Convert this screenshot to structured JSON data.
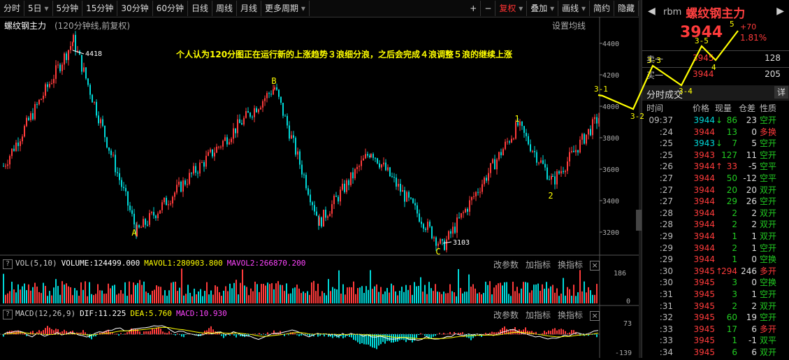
{
  "toolbar": {
    "items": [
      "分时",
      "5日",
      "5分钟",
      "15分钟",
      "30分钟",
      "60分钟",
      "日线",
      "周线",
      "月线",
      "更多周期"
    ],
    "right_items": [
      "+",
      "−",
      "复权",
      "叠加",
      "画线",
      "简约",
      "隐藏"
    ],
    "dropdown_items": [
      "5日",
      "更多周期",
      "复权",
      "叠加",
      "画线"
    ],
    "active_item": "复权"
  },
  "main_chart": {
    "symbol_label": "螺纹钢主力",
    "period_label": "(120分钟线,前复权)",
    "settings_label": "设置均线",
    "annotation": "个人认为120分图正在运行新的上涨趋势３浪细分浪，之后会完成４浪调整５浪的继续上涨",
    "high_label": "4418",
    "low_label": "3103",
    "wave_labels": [
      "A",
      "B",
      "C",
      "1",
      "2"
    ],
    "forecast_labels": [
      "3-1",
      "3-2",
      "3-3",
      "3-4",
      "3-5",
      "4",
      "5"
    ],
    "colors": {
      "up": "#ff3b3b",
      "down": "#00d8d8",
      "annotation": "#ffff00",
      "wave": "#ffff00"
    }
  },
  "volume_panel": {
    "indicator_label": "VOL(5,10)",
    "volume_text": "VOLUME:124499.000",
    "mavol1_text": "MAVOL1:280903.800",
    "mavol2_text": "MAVOL2:266870.200",
    "buttons": [
      "改参数",
      "加指标",
      "换指标"
    ],
    "axis_labels": [
      "186",
      "0"
    ]
  },
  "macd_panel": {
    "indicator_label": "MACD(12,26,9)",
    "dif_text": "DIF:11.225",
    "dea_text": "DEA:5.760",
    "macd_text": "MACD:10.930",
    "buttons": [
      "改参数",
      "加指标",
      "换指标"
    ],
    "axis_labels": [
      "73",
      "-139"
    ]
  },
  "quote_panel": {
    "code": "rbm",
    "name": "螺纹钢主力",
    "price": "3944",
    "change": "+70",
    "change_pct": "1.81%",
    "ask_label": "卖一",
    "ask_price": "3945",
    "ask_vol": "128",
    "bid_label": "买一",
    "bid_price": "3944",
    "bid_vol": "205",
    "tab_label": "分时成交",
    "detail_label": "详",
    "columns": [
      "时间",
      "价格",
      "现量",
      "仓差",
      "性质"
    ],
    "ticks": [
      {
        "time": "09:37",
        "price": "3944",
        "dir": "↓",
        "vol": "86",
        "oi": "23",
        "nature": "空开"
      },
      {
        "time": ":24",
        "price": "3944",
        "dir": "",
        "vol": "13",
        "oi": "0",
        "nature": "多换"
      },
      {
        "time": ":25",
        "price": "3943",
        "dir": "↓",
        "vol": "7",
        "oi": "5",
        "nature": "空开"
      },
      {
        "time": ":25",
        "price": "3943",
        "dir": "",
        "vol": "127",
        "oi": "11",
        "nature": "空开"
      },
      {
        "time": ":26",
        "price": "3944",
        "dir": "↑",
        "vol": "33",
        "oi": "-5",
        "nature": "空平"
      },
      {
        "time": ":27",
        "price": "3944",
        "dir": "",
        "vol": "50",
        "oi": "-12",
        "nature": "空平"
      },
      {
        "time": ":27",
        "price": "3944",
        "dir": "",
        "vol": "20",
        "oi": "20",
        "nature": "双开"
      },
      {
        "time": ":27",
        "price": "3944",
        "dir": "",
        "vol": "29",
        "oi": "26",
        "nature": "空开"
      },
      {
        "time": ":28",
        "price": "3944",
        "dir": "",
        "vol": "2",
        "oi": "2",
        "nature": "双开"
      },
      {
        "time": ":28",
        "price": "3944",
        "dir": "",
        "vol": "2",
        "oi": "2",
        "nature": "双开"
      },
      {
        "time": ":29",
        "price": "3944",
        "dir": "",
        "vol": "1",
        "oi": "1",
        "nature": "双开"
      },
      {
        "time": ":29",
        "price": "3944",
        "dir": "",
        "vol": "2",
        "oi": "1",
        "nature": "空开"
      },
      {
        "time": ":29",
        "price": "3944",
        "dir": "",
        "vol": "1",
        "oi": "0",
        "nature": "空换"
      },
      {
        "time": ":30",
        "price": "3945",
        "dir": "↑",
        "vol": "294",
        "oi": "246",
        "nature": "多开"
      },
      {
        "time": ":30",
        "price": "3945",
        "dir": "",
        "vol": "3",
        "oi": "0",
        "nature": "空换"
      },
      {
        "time": ":31",
        "price": "3945",
        "dir": "",
        "vol": "3",
        "oi": "1",
        "nature": "空开"
      },
      {
        "time": ":31",
        "price": "3945",
        "dir": "",
        "vol": "2",
        "oi": "2",
        "nature": "双开"
      },
      {
        "time": ":32",
        "price": "3945",
        "dir": "",
        "vol": "60",
        "oi": "19",
        "nature": "空开"
      },
      {
        "time": ":33",
        "price": "3945",
        "dir": "",
        "vol": "17",
        "oi": "6",
        "nature": "多开"
      },
      {
        "time": ":33",
        "price": "3945",
        "dir": "",
        "vol": "1",
        "oi": "-1",
        "nature": "双平"
      },
      {
        "time": ":34",
        "price": "3945",
        "dir": "",
        "vol": "6",
        "oi": "6",
        "nature": "双开"
      }
    ]
  },
  "chart_data": {
    "type": "candlestick",
    "y_ticks": [
      4400,
      4200,
      4000,
      3800,
      3600,
      3400,
      3200
    ],
    "ylim": [
      3080,
      4480
    ],
    "key_points": [
      {
        "label": "start",
        "value": 3620
      },
      {
        "label": "4418",
        "value": 4418
      },
      {
        "label": "A",
        "value": 3200
      },
      {
        "label": "B",
        "value": 4120
      },
      {
        "label": "mid_low",
        "value": 3260
      },
      {
        "label": "mid_high",
        "value": 3720
      },
      {
        "label": "3103",
        "value": 3103
      },
      {
        "label": "1",
        "value": 3880
      },
      {
        "label": "2",
        "value": 3520
      },
      {
        "label": "current",
        "value": 3944
      }
    ],
    "forecast_path": [
      {
        "label": "3-1",
        "value": 4060
      },
      {
        "label": "3-2",
        "value": 4020
      },
      {
        "label": "3-3",
        "value": 4380
      },
      {
        "label": "3-4",
        "value": 4190
      },
      {
        "label": "3-5",
        "value": 4530
      },
      {
        "label": "4",
        "value": 4430
      },
      {
        "label": "5",
        "value": 4640
      }
    ]
  }
}
